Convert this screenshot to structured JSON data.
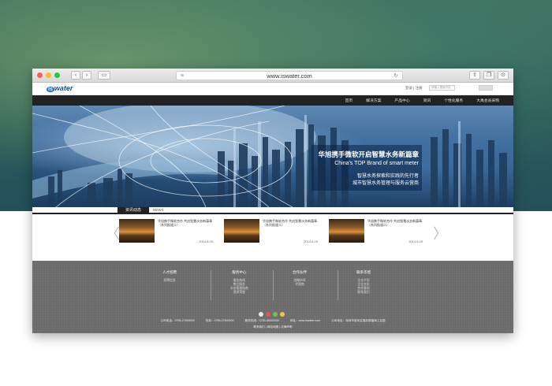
{
  "browser": {
    "url": "www.iswater.com"
  },
  "site": {
    "logo_badge": "is",
    "logo_text": "water",
    "header_links": "登录 | 注册",
    "search_placeholder": "请输入搜索内容",
    "nav": [
      "首页",
      "解决方案",
      "产品中心",
      "资讯",
      "个性化服务",
      "大禹会员采购"
    ]
  },
  "hero": {
    "title": "华旭携手微软开启智慧水务新篇章",
    "subtitle": "China's TOP Brand of smart meter",
    "line3": "智慧水务探索和实践的先行者",
    "line4": "城市智慧水务管理与服务云营商"
  },
  "news": {
    "tab_label": "资讯动态",
    "tab_en": "NEWS",
    "prev_arrow": "〈",
    "next_arrow": "〉",
    "cards": [
      {
        "title": "华旭携手微软合作 共启智慧水务新篇章（系列报道二）",
        "date": "2014.8.29"
      },
      {
        "title": "华旭携手微软合作 共启智慧水务新篇章（系列报道二）",
        "date": "2014.8.29"
      },
      {
        "title": "华旭携手微软合作 共启智慧水务新篇章（系列报道二）",
        "date": "2014.8.29"
      }
    ]
  },
  "footer": {
    "columns": [
      {
        "head": "人才招聘",
        "items": [
          "招聘信息"
        ]
      },
      {
        "head": "服务中心",
        "items": [
          "服务热线",
          "售后服务",
          "水务管理指南",
          "资质荣誉"
        ]
      },
      {
        "head": "合作伙伴",
        "items": [
          "战略伙伴",
          "代理商"
        ]
      },
      {
        "head": "联系华旭",
        "items": [
          "企业介绍",
          "企业文化",
          "合作意向",
          "联系我们"
        ]
      }
    ],
    "contacts": [
      "公司电话：0755-27800000",
      "传真：0755-27800000",
      "服务热线：0755-88000000",
      "网址：www.iswater.com",
      "公司地址：深圳市宝安区福永镇福海工业园"
    ],
    "bottom_links": "联系我们 | 网站地图 | 法律声明"
  }
}
